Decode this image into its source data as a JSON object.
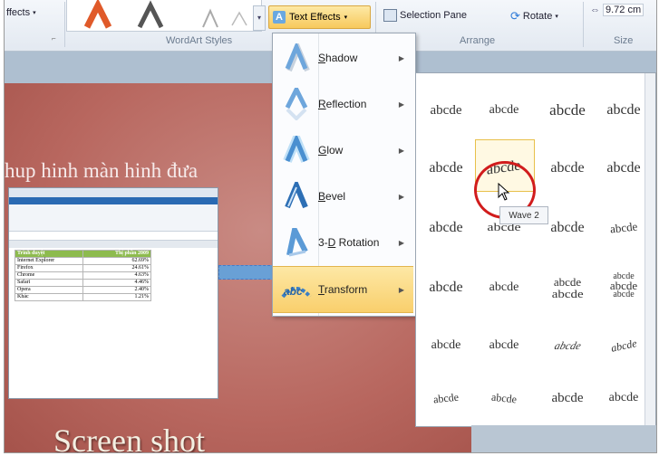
{
  "ribbon": {
    "effects_label": "ffects",
    "wordart_styles_label": "WordArt Styles",
    "text_effects_label": "Text Effects",
    "selection_pane_label": "Selection Pane",
    "rotate_label": "Rotate",
    "arrange_label": "Arrange",
    "size_value": "9.72 cm",
    "size_label": "Size"
  },
  "slide": {
    "line_text": "hup hinh màn hinh đưa",
    "title_text": "Screen shot"
  },
  "excel": {
    "headers": [
      "Trinh duyệt",
      "Thị phần 2009"
    ],
    "rows": [
      [
        "Internet Explorer",
        "62.69%"
      ],
      [
        "Firefox",
        "24.61%"
      ],
      [
        "Chrome",
        "4.63%"
      ],
      [
        "Safari",
        "4.46%"
      ],
      [
        "Opera",
        "2.40%"
      ],
      [
        "Khác",
        "1.21%"
      ]
    ]
  },
  "menu": {
    "items": [
      {
        "label": "Shadow",
        "key": "S"
      },
      {
        "label": "Reflection",
        "key": "R"
      },
      {
        "label": "Glow",
        "key": "G"
      },
      {
        "label": "Bevel",
        "key": "B"
      },
      {
        "label": "3-D Rotation",
        "key": "D"
      },
      {
        "label": "Transform",
        "key": "T"
      }
    ],
    "active_item": "Transform"
  },
  "gallery": {
    "sample_text": "abcde",
    "tooltip": "Wave 2"
  },
  "colors": {
    "slide_bg": "#b8675f",
    "menu_highlight": "#f9cf6c",
    "circle_marker": "#d11c1c",
    "excel_header": "#8dbb4e"
  }
}
